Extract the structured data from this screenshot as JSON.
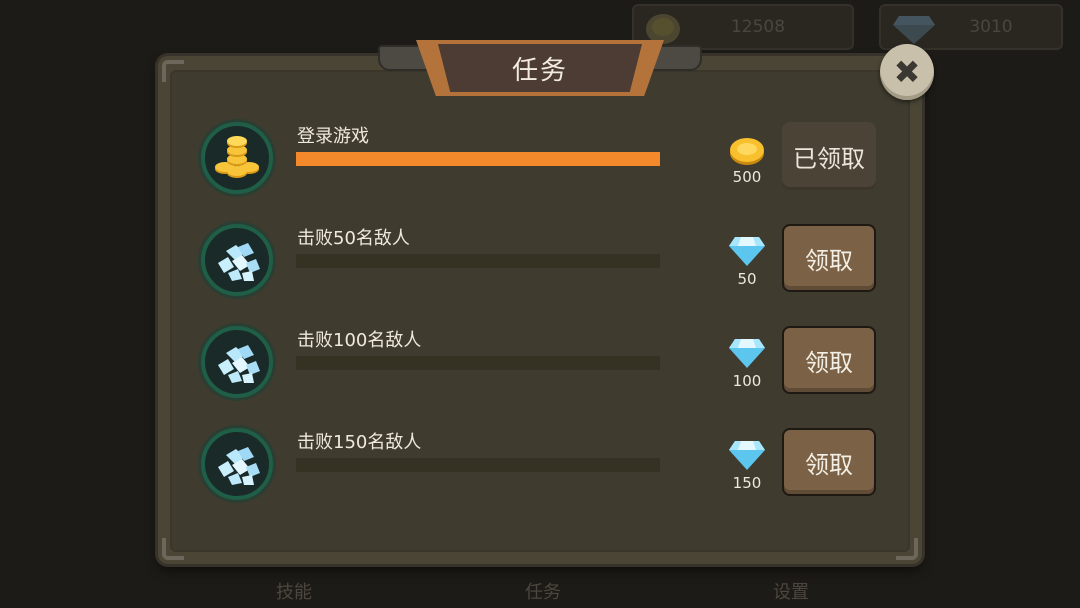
{
  "hud": {
    "coins": "12508",
    "gems": "3010",
    "coin_icon": "coin-icon",
    "gem_icon": "diamond-icon"
  },
  "bottom_nav": [
    "技能",
    "任务",
    "设置"
  ],
  "dialog": {
    "title": "任务",
    "close_icon": "close-icon",
    "tasks": [
      {
        "name": "登录游戏",
        "progress": 1.0,
        "reward_type": "coin",
        "reward": "500",
        "button": "已领取",
        "claimed": true
      },
      {
        "name": "击败50名敌人",
        "progress": 0.0,
        "reward_type": "diamond",
        "reward": "50",
        "button": "领取",
        "claimed": false
      },
      {
        "name": "击败100名敌人",
        "progress": 0.0,
        "reward_type": "diamond",
        "reward": "100",
        "button": "领取",
        "claimed": false
      },
      {
        "name": "击败150名敌人",
        "progress": 0.0,
        "reward_type": "diamond",
        "reward": "150",
        "button": "领取",
        "claimed": false
      }
    ]
  },
  "colors": {
    "panel": "#4a4535",
    "progress_fill": "#f4892b",
    "banner": "#b4733a",
    "button": "#7b6246"
  }
}
